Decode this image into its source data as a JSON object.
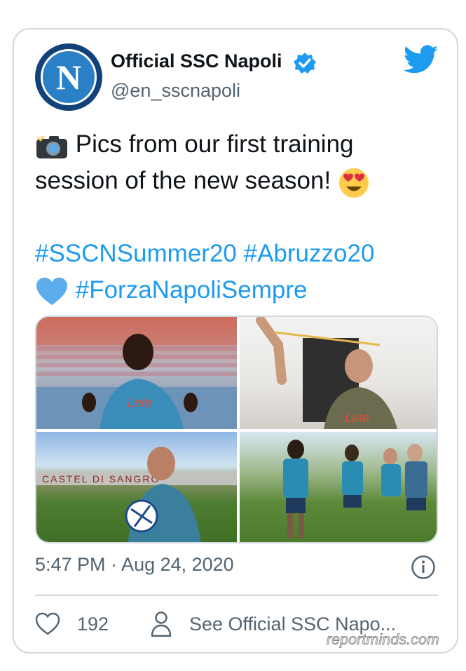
{
  "tweet": {
    "author_name": "Official SSC Napoli",
    "handle": "@en_sscnapoli",
    "avatar_letter": "N",
    "verified": true,
    "text_line1": "Pics from our first training",
    "text_line2": "session of the new season!",
    "hashtags": [
      "#SSCNSummer20",
      "#Abruzzo20",
      "#ForzaNapoliSempre"
    ],
    "emojis": [
      "camera-with-flash",
      "heart-eyes",
      "blue-heart"
    ],
    "timestamp": "5:47 PM · Aug 24, 2020",
    "likes": "192",
    "profile_link": "See Official SSC Napo..."
  },
  "photos": [
    {
      "name": "photo-player-thumbs-up",
      "kit_text": "Lete"
    },
    {
      "name": "photo-player-gym-resistance-band",
      "kit_text": "Lete"
    },
    {
      "name": "photo-player-with-ball-stadium",
      "stadium_text": "CASTEL DI SANGRO"
    },
    {
      "name": "photo-players-training-pitch"
    }
  ],
  "watermark": "reportminds.com",
  "colors": {
    "link": "#1d9bf0",
    "text": "#0f1419",
    "secondary": "#536471",
    "border": "#cfd9de",
    "napoli_blue": "#2a80c6"
  },
  "icons": [
    "twitter-bird-icon",
    "verified-badge-icon",
    "info-icon",
    "heart-icon",
    "person-icon"
  ]
}
